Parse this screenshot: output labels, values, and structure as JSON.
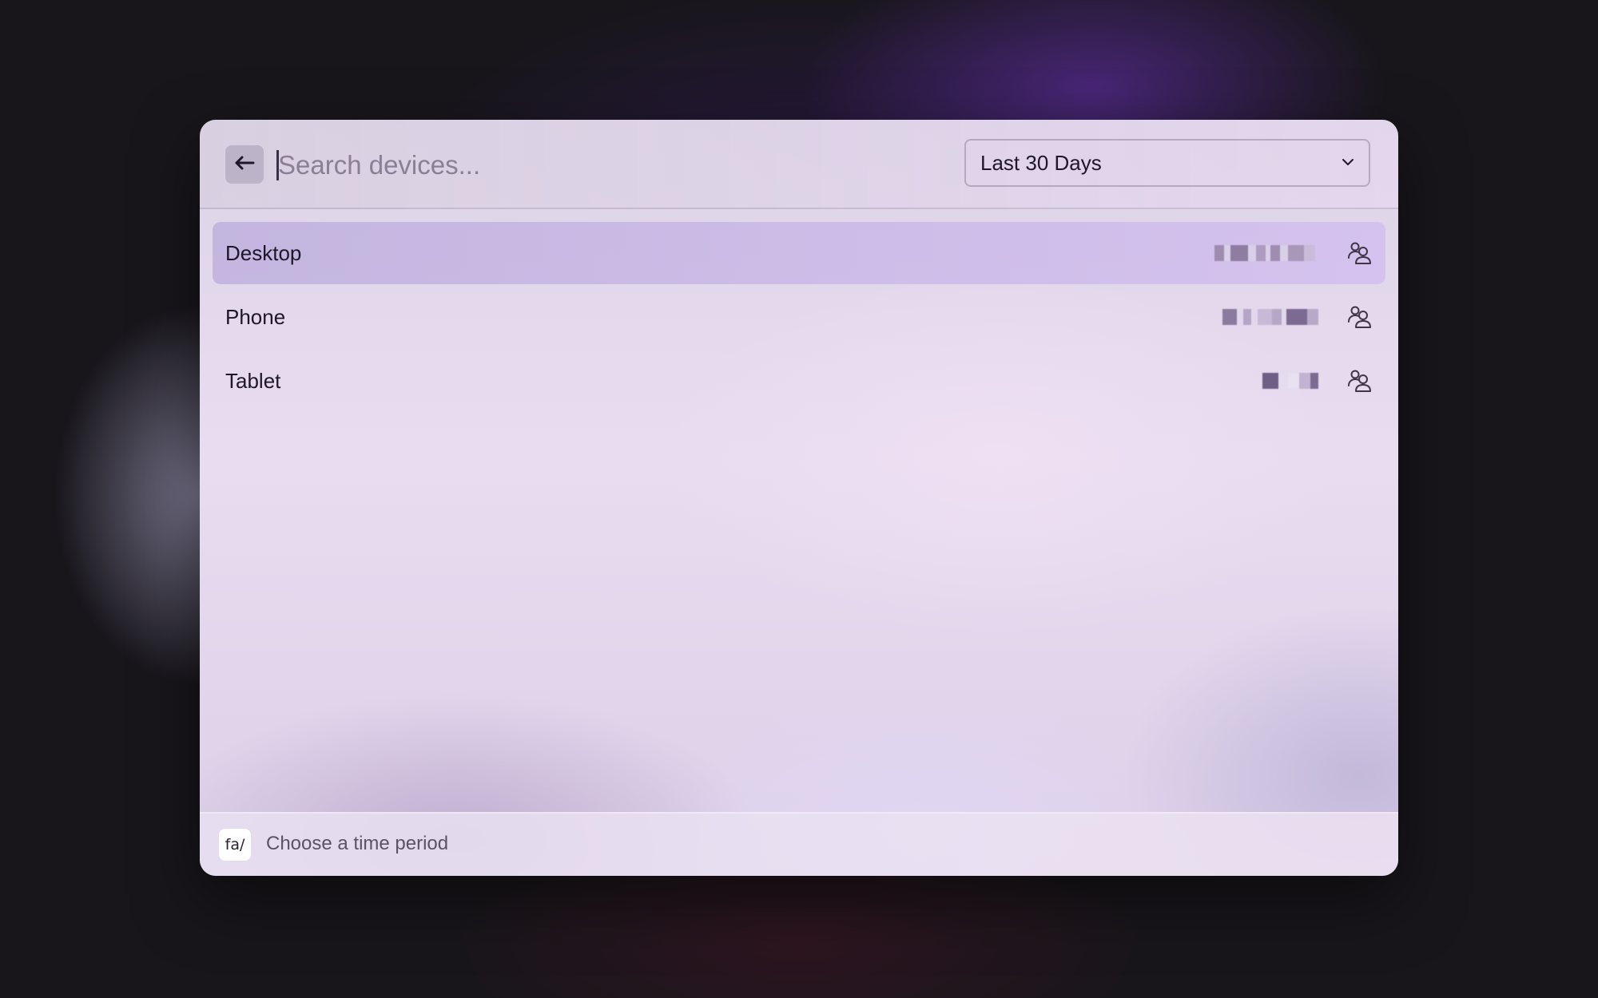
{
  "search": {
    "placeholder": "Search devices...",
    "value": ""
  },
  "time_select": {
    "selected": "Last 30 Days"
  },
  "devices": [
    {
      "label": "Desktop",
      "selected": true,
      "value_redacted": true
    },
    {
      "label": "Phone",
      "selected": false,
      "value_redacted": true
    },
    {
      "label": "Tablet",
      "selected": false,
      "value_redacted": true
    }
  ],
  "footer": {
    "key_hint": "fa/",
    "text": "Choose a time period"
  },
  "icons": {
    "back": "arrow-left-icon",
    "dropdown": "chevron-down-icon",
    "row": "users-icon"
  },
  "colors": {
    "background": "#18161b",
    "accent": "#3a2f47",
    "selected_row": "#c4b4e4",
    "text": "#1e1729",
    "muted_text": "#5c5268"
  }
}
